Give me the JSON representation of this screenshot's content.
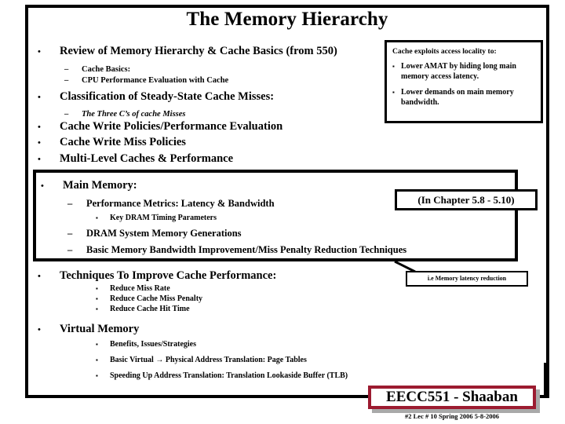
{
  "slide": {
    "title": "The Memory Hierarchy",
    "bullet_marker": "•",
    "dash_marker": "–",
    "square_marker": "▪"
  },
  "outline": {
    "review": {
      "label": "Review of Memory Hierarchy & Cache Basics (from 550)",
      "sub": [
        "Cache Basics:",
        "CPU Performance Evaluation with Cache"
      ]
    },
    "classification": {
      "label": "Classification of Steady-State Cache Misses:",
      "sub": [
        "The Three C’s of cache Misses"
      ]
    },
    "write_policies": "Cache Write Policies/Performance Evaluation",
    "write_miss_policies": "Cache Write Miss Policies",
    "multi_level": "Multi-Level Caches & Performance",
    "main_memory": {
      "label": "Main Memory:",
      "sub": [
        "Performance Metrics: Latency & Bandwidth",
        "DRAM System Memory Generations",
        "Basic Memory Bandwidth Improvement/Miss Penalty Reduction Techniques"
      ],
      "sub_sub": "Key DRAM Timing Parameters"
    },
    "techniques": {
      "label": "Techniques To Improve Cache Performance:",
      "sub": [
        "Reduce Miss Rate",
        "Reduce Cache Miss Penalty",
        "Reduce Cache Hit Time"
      ]
    },
    "virtual_memory": {
      "label": "Virtual Memory",
      "sub": [
        "Benefits, Issues/Strategies",
        "Basic Virtual → Physical Address Translation: Page Tables",
        "Speeding Up Address Translation: Translation Lookaside Buffer (TLB)"
      ]
    }
  },
  "cache_callout": {
    "heading": "Cache exploits access locality to:",
    "items": [
      "Lower AMAT by hiding long main memory access latency.",
      "Lower demands on main memory bandwidth."
    ]
  },
  "chapter_callout": {
    "text": "(In Chapter  5.8 - 5.10)"
  },
  "latency_callout": {
    "text": "i.e Memory latency reduction"
  },
  "footer": {
    "course": "EECC551 - Shaaban",
    "meta": "#2   Lec # 10   Spring 2006  5-8-2006",
    "accent_color": "#9c1b30",
    "shadow_color": "#a9a9a9"
  }
}
